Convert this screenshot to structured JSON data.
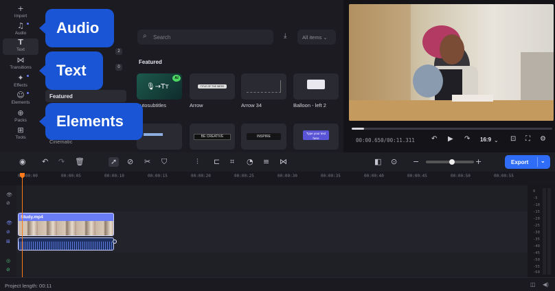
{
  "rail": {
    "items": [
      {
        "icon": "+",
        "label": "Import"
      },
      {
        "icon": "♫",
        "label": "Audio"
      },
      {
        "icon": "T",
        "label": "Text"
      },
      {
        "icon": "⋈",
        "label": "Transitions"
      },
      {
        "icon": "✦",
        "label": "Effects"
      },
      {
        "icon": "☺",
        "label": "Elements"
      },
      {
        "icon": "⊕",
        "label": "Packs"
      },
      {
        "icon": "⊞",
        "label": "Tools"
      }
    ]
  },
  "categories": {
    "count1": "2",
    "count2": "0",
    "featured": "Featured",
    "cinematic": "Cinematic"
  },
  "library": {
    "search_placeholder": "Search",
    "filter_label": "All items ⌄",
    "featured_heading": "Featured",
    "tiles": [
      {
        "title": "Autosubtitles",
        "badge": "AI"
      },
      {
        "title": "Arrow",
        "art_text": "TITLE OF THE WEEK"
      },
      {
        "title": "Arrow 34"
      },
      {
        "title": "Balloon - left 2"
      },
      {
        "title": ""
      },
      {
        "title": "",
        "art_text": "BE CREATIVE"
      },
      {
        "title": "",
        "art_text": "INSPIRE"
      },
      {
        "title": "",
        "art_text": "Type your text here"
      }
    ]
  },
  "callouts": {
    "audio": "Audio",
    "text": "Text",
    "elements": "Elements"
  },
  "player": {
    "timecode": "00:00.650/00:11.311",
    "ratio": "16:9",
    "progress": 0.06
  },
  "toolbar": {
    "export_label": "Export"
  },
  "ruler": {
    "ticks": [
      "00:00:00",
      "00:00:05",
      "00:00:10",
      "00:00:15",
      "00:00:20",
      "00:00:25",
      "00:00:30",
      "00:00:35",
      "00:00:40",
      "00:00:45",
      "00:00:50",
      "00:00:55"
    ]
  },
  "timeline": {
    "clip_name": "Study.mp4"
  },
  "meter": {
    "levels": [
      "0",
      "-5",
      "-10",
      "-15",
      "-20",
      "-25",
      "-30",
      "-35",
      "-40",
      "-45",
      "-50",
      "-55",
      "-60"
    ]
  },
  "status": {
    "project_length": "Project length: 00:11"
  },
  "colors": {
    "accent": "#2f6df6",
    "callout": "#1a55d6",
    "clip": "#6b7cf7",
    "playhead": "#ff7a1a"
  }
}
